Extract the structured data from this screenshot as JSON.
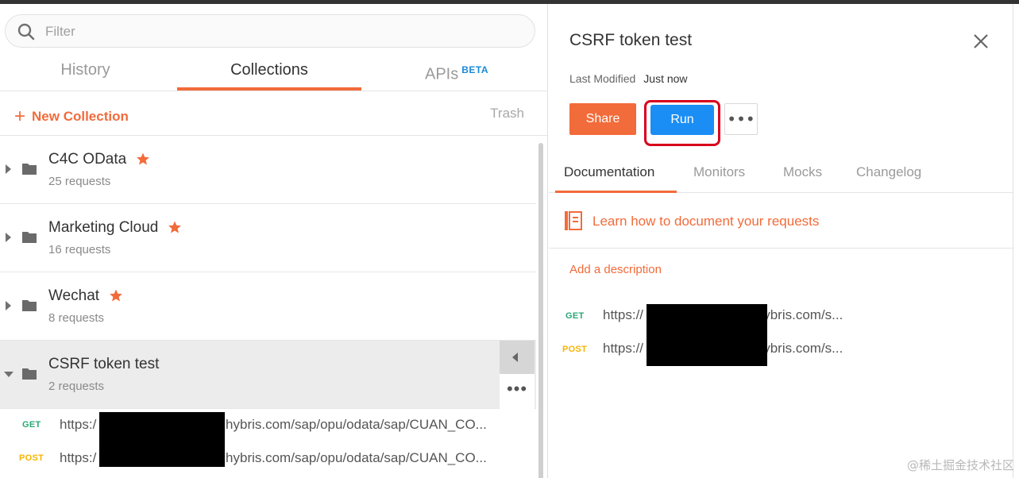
{
  "sidebar": {
    "filter_placeholder": "Filter",
    "tabs": {
      "history": "History",
      "collections": "Collections",
      "apis": "APIs",
      "apis_badge": "BETA"
    },
    "new_collection_label": "New Collection",
    "trash_label": "Trash",
    "collections": [
      {
        "name": "C4C OData",
        "requests": "25 requests",
        "starred": true
      },
      {
        "name": "Marketing Cloud",
        "requests": "16 requests",
        "starred": true
      },
      {
        "name": "Wechat",
        "requests": "8 requests",
        "starred": true
      },
      {
        "name": "CSRF token test",
        "requests": "2 requests",
        "starred": false,
        "expanded": true
      }
    ],
    "expanded_requests": [
      {
        "method": "GET",
        "url_prefix": "https:/",
        "url_suffix": ".hybris.com/sap/opu/odata/sap/CUAN_CO..."
      },
      {
        "method": "POST",
        "url_prefix": "https:/",
        "url_suffix": ".hybris.com/sap/opu/odata/sap/CUAN_CO..."
      }
    ],
    "more_glyph": "•••"
  },
  "panel": {
    "title": "CSRF token test",
    "last_modified_label": "Last Modified",
    "last_modified_value": "Just now",
    "share_label": "Share",
    "run_label": "Run",
    "more_glyph": "•••",
    "tabs": [
      "Documentation",
      "Monitors",
      "Mocks",
      "Changelog"
    ],
    "learn_link": "Learn how to document your requests",
    "add_description": "Add a description",
    "requests": [
      {
        "method": "GET",
        "url_prefix": "https://",
        "url_suffix": ".hybris.com/s..."
      },
      {
        "method": "POST",
        "url_prefix": "https://",
        "url_suffix": ".hybris.com/s..."
      }
    ]
  },
  "colors": {
    "accent_orange": "#f26b3a",
    "run_blue": "#1a8ef5",
    "highlight_red": "#d8001b",
    "get_green": "#2aa876",
    "post_yellow": "#f7b500"
  },
  "watermark": "@稀土掘金技术社区"
}
